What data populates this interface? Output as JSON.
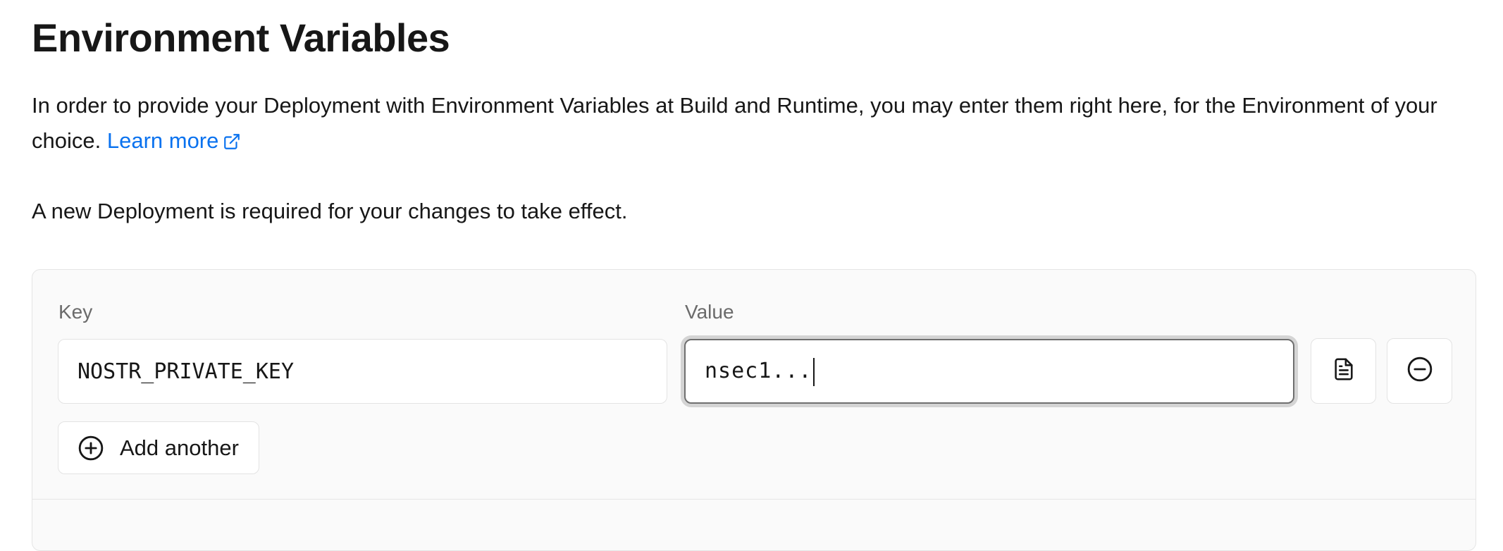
{
  "page": {
    "title": "Environment Variables",
    "description": "In order to provide your Deployment with Environment Variables at Build and Runtime, you may enter them right here, for the Environment of your choice. ",
    "learn_more_label": "Learn more",
    "notice": "A new Deployment is required for your changes to take effect."
  },
  "env_form": {
    "key_label": "Key",
    "value_label": "Value",
    "rows": [
      {
        "key": "NOSTR_PRIVATE_KEY",
        "value": "nsec1..."
      }
    ],
    "add_button_label": "Add another"
  },
  "icons": {
    "learn_more": "external-link-icon",
    "paste": "document-icon",
    "remove": "minus-circle-icon",
    "add": "plus-circle-icon"
  },
  "colors": {
    "text": "#171717",
    "muted_text": "#6b6b6b",
    "link": "#0a72ef",
    "panel_background": "#fafafa",
    "border": "#e3e3e3",
    "focus_ring": "#d4d4d4"
  }
}
